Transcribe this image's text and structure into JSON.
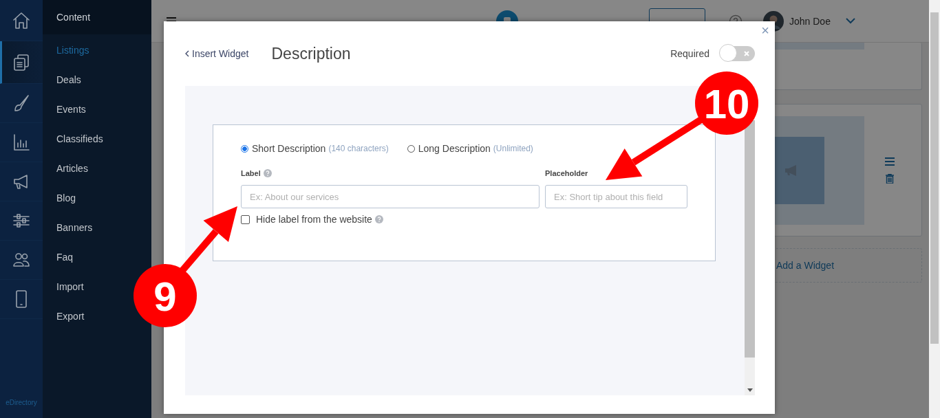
{
  "rail": {
    "items": [
      {
        "kind": "home",
        "selected": false
      },
      {
        "kind": "documents",
        "selected": true
      },
      {
        "kind": "brush",
        "selected": false
      },
      {
        "kind": "chart",
        "selected": false
      },
      {
        "kind": "megaphone",
        "selected": false
      },
      {
        "kind": "sliders",
        "selected": false
      },
      {
        "kind": "users",
        "selected": false
      },
      {
        "kind": "tablet",
        "selected": false
      }
    ],
    "brand": "eDirectory"
  },
  "menu": {
    "title": "Content",
    "items": [
      {
        "label": "Listings",
        "selected": true
      },
      {
        "label": "Deals",
        "selected": false
      },
      {
        "label": "Events",
        "selected": false
      },
      {
        "label": "Classifieds",
        "selected": false
      },
      {
        "label": "Articles",
        "selected": false
      },
      {
        "label": "Blog",
        "selected": false
      },
      {
        "label": "Banners",
        "selected": false
      },
      {
        "label": "Faq",
        "selected": false
      },
      {
        "label": "Import",
        "selected": false
      },
      {
        "label": "Export",
        "selected": false
      }
    ]
  },
  "header": {
    "user": "John Doe"
  },
  "background": {
    "add_widget": "Add a Widget"
  },
  "modal": {
    "close": "×",
    "back_link": "Insert Widget",
    "title": "Description",
    "required": {
      "label": "Required",
      "on": false
    },
    "options": [
      {
        "label": "Short Description",
        "hint": "(140 characters)",
        "selected": true
      },
      {
        "label": "Long Description",
        "hint": "(Unlimited)",
        "selected": false
      }
    ],
    "label_field": {
      "label": "Label",
      "placeholder": "Ex: About our services"
    },
    "placeholder_field": {
      "label": "Placeholder",
      "placeholder": "Ex: Short tip about this field"
    },
    "hide_label": {
      "label": "Hide label from the website",
      "checked": false
    }
  },
  "annotations": [
    {
      "number": "10"
    },
    {
      "number": "9"
    }
  ]
}
